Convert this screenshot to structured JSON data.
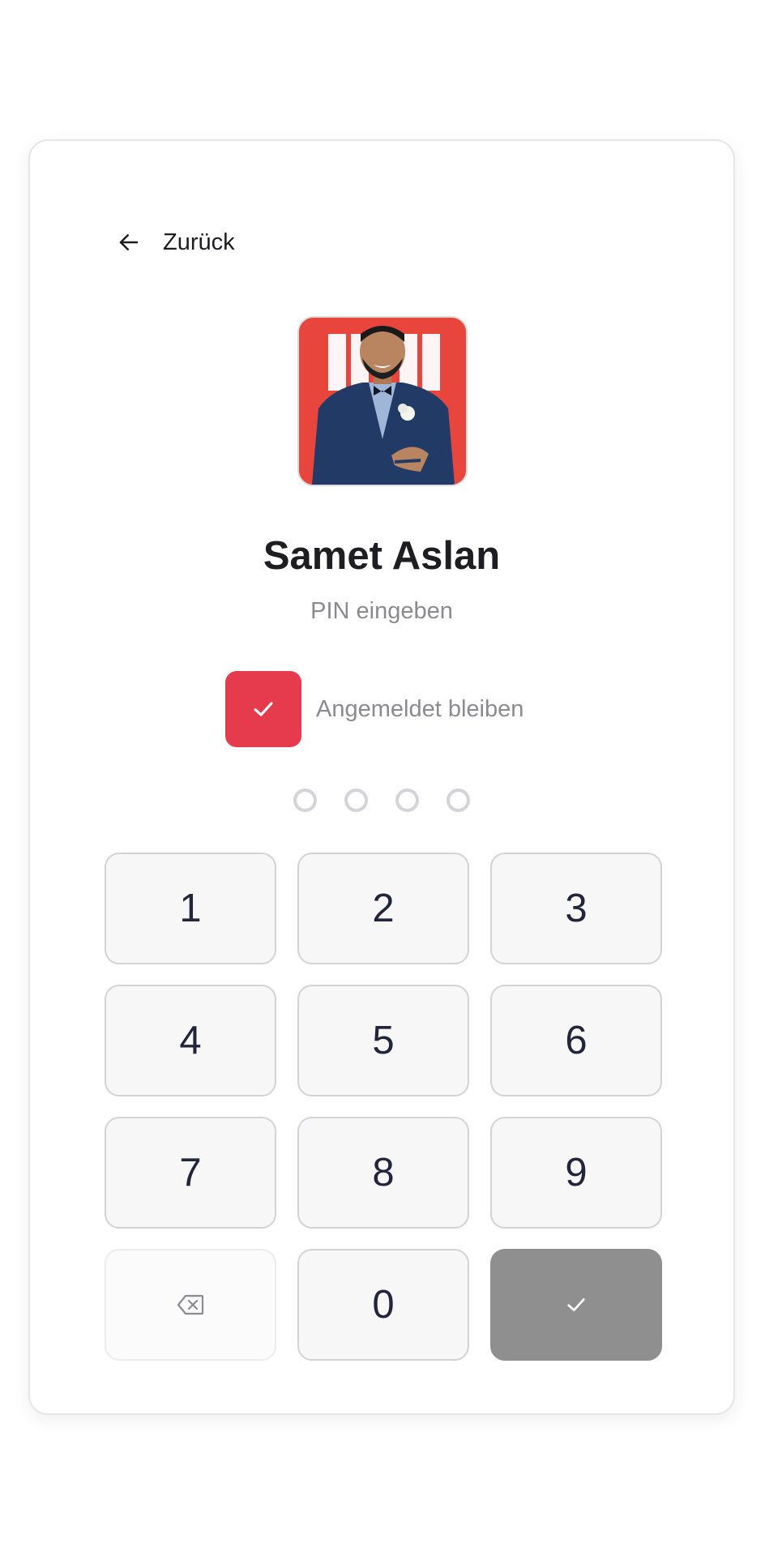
{
  "header": {
    "back_label": "Zurück",
    "back_icon": "arrow-left-icon"
  },
  "profile": {
    "name": "Samet Aslan",
    "avatar_bg": "#e8463c"
  },
  "prompt": "PIN eingeben",
  "remember": {
    "label": "Angemeldet bleiben",
    "checked": true,
    "color": "#e53b4c"
  },
  "pin": {
    "length": 4,
    "entered": 0
  },
  "keypad": {
    "digits": [
      "1",
      "2",
      "3",
      "4",
      "5",
      "6",
      "7",
      "8",
      "9",
      "0"
    ],
    "delete_icon": "backspace-icon",
    "confirm_icon": "check-icon",
    "confirm_color": "#8f8f8f"
  }
}
